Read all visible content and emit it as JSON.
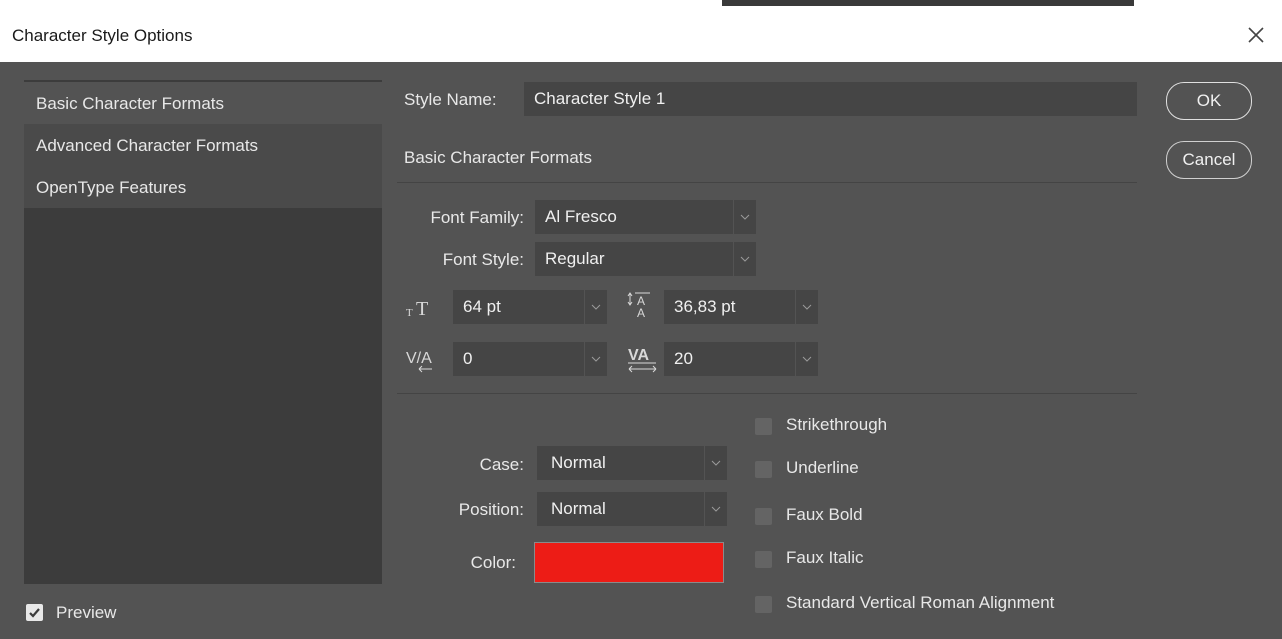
{
  "window": {
    "title": "Character Style Options"
  },
  "nav": {
    "items": [
      {
        "label": "Basic Character Formats"
      },
      {
        "label": "Advanced Character Formats"
      },
      {
        "label": "OpenType Features"
      }
    ]
  },
  "preview": {
    "label": "Preview",
    "checked": true
  },
  "style_name": {
    "label": "Style Name:",
    "value": "Character Style 1"
  },
  "section": {
    "heading": "Basic Character Formats"
  },
  "font": {
    "family_label": "Font Family:",
    "family_value": "Al Fresco",
    "style_label": "Font Style:",
    "style_value": "Regular"
  },
  "metrics": {
    "size_value": "64 pt",
    "leading_value": "36,83 pt",
    "kerning_value": "0",
    "tracking_value": "20"
  },
  "case": {
    "label": "Case:",
    "value": "Normal"
  },
  "position": {
    "label": "Position:",
    "value": "Normal"
  },
  "color": {
    "label": "Color:",
    "value": "#ed1c16"
  },
  "options": [
    {
      "label": "Strikethrough",
      "checked": false
    },
    {
      "label": "Underline",
      "checked": false
    },
    {
      "label": "Faux Bold",
      "checked": false
    },
    {
      "label": "Faux Italic",
      "checked": false
    },
    {
      "label": "Standard Vertical Roman Alignment",
      "checked": false
    }
  ],
  "buttons": {
    "ok": "OK",
    "cancel": "Cancel"
  }
}
